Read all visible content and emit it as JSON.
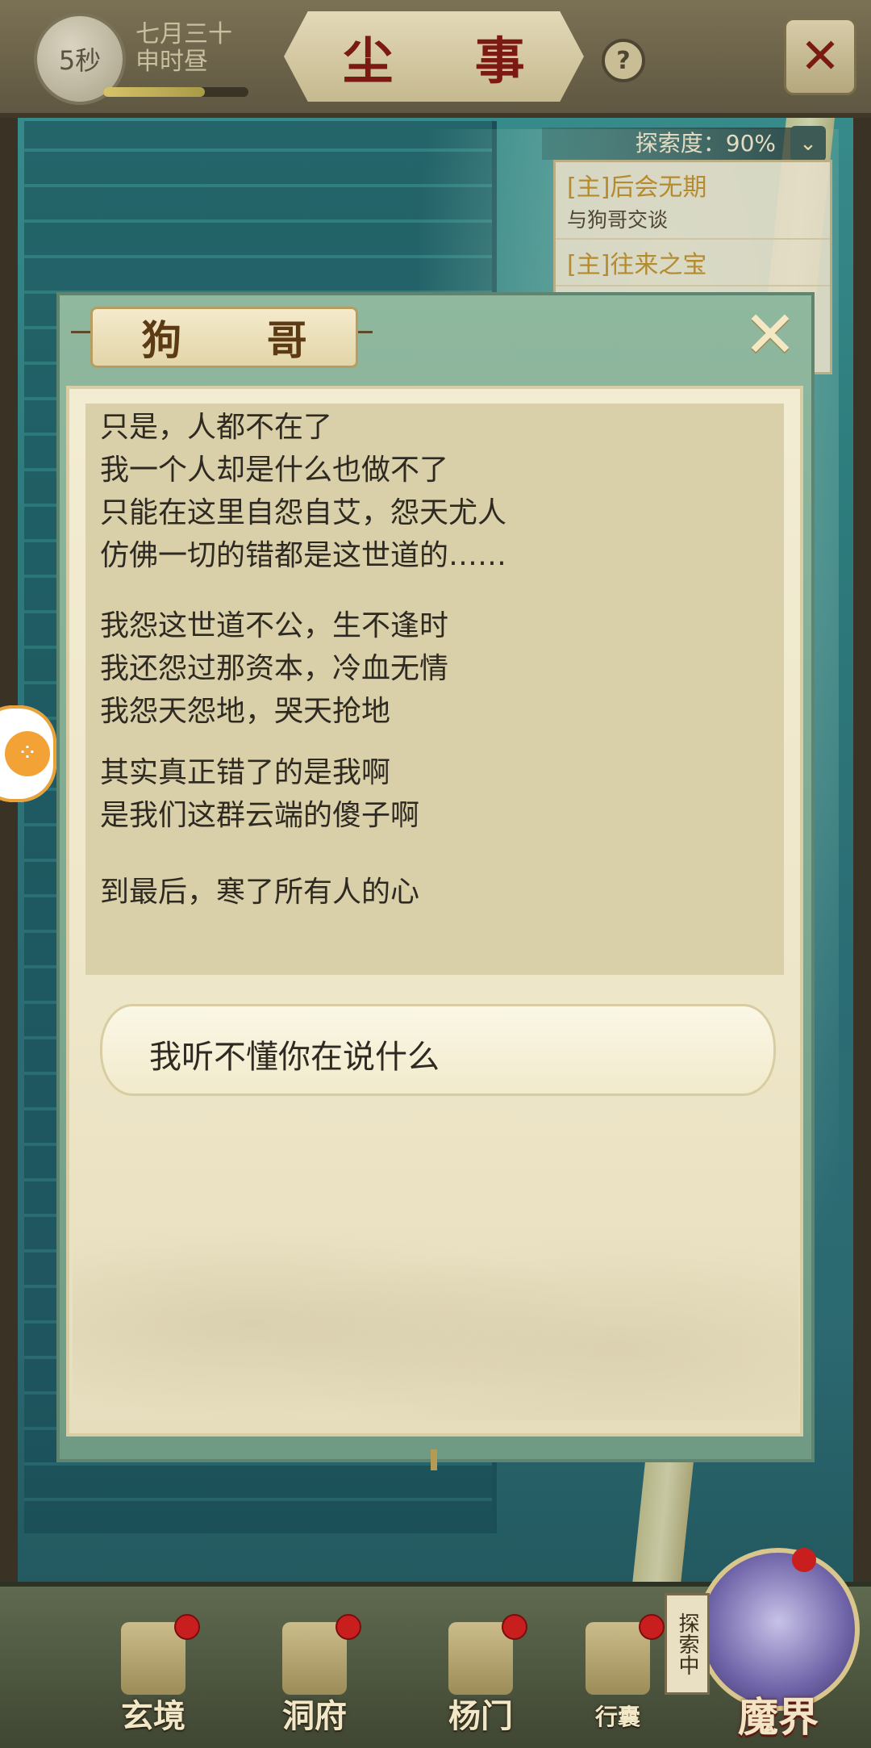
{
  "header": {
    "timer": "5秒",
    "date_line1": "七月三十",
    "date_line2": "申时昼",
    "title": "尘 事",
    "help_icon": "?",
    "fullscreen_icon": "✕"
  },
  "quest": {
    "exploration": "探索度：90%",
    "items": [
      {
        "title": "[主]后会无期",
        "subtitle": "与狗哥交谈"
      },
      {
        "title": "[主]往来之宝",
        "subtitle": ""
      }
    ]
  },
  "dialog": {
    "title": "狗 哥",
    "close_icon": "✕",
    "lines": [
      "只是，人都不在了",
      "我一个人却是什么也做不了",
      "只能在这里自怨自艾，怨天尤人",
      "仿佛一切的错都是这世道的……",
      "我怨这世道不公，生不逢时",
      "我还怨过那资本，冷血无情",
      "我怨天怨地，哭天抢地",
      "其实真正错了的是我啊",
      "是我们这群云端的傻子啊",
      "到最后，寒了所有人的心"
    ],
    "answer": "我听不懂你在说什么"
  },
  "nav": {
    "items": [
      "玄境",
      "洞府",
      "杨门",
      "行囊"
    ],
    "realm": "魔界",
    "exploring": "探索中"
  }
}
